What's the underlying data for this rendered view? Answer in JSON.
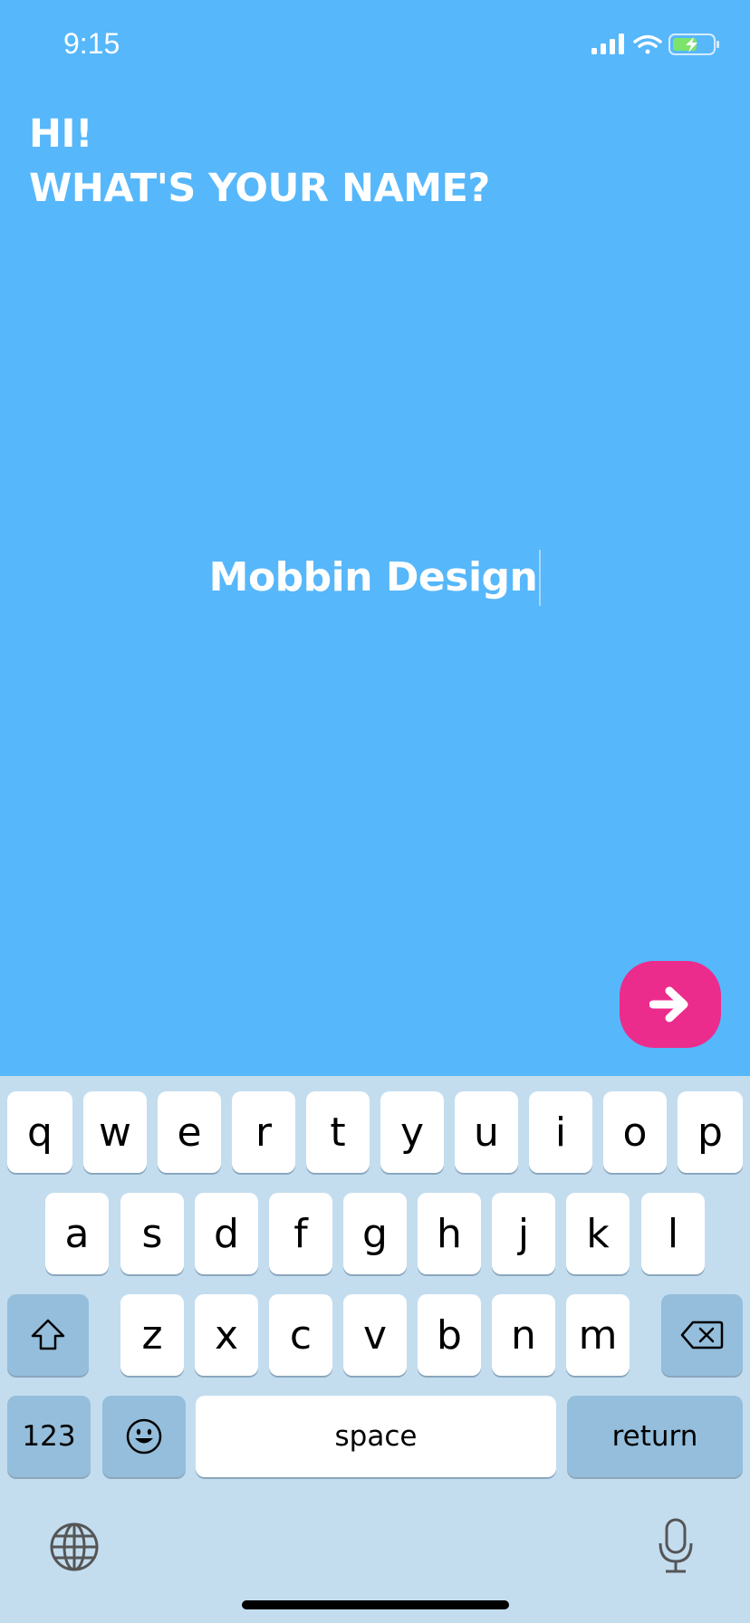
{
  "status_bar": {
    "time": "9:15"
  },
  "heading": {
    "line1": "HI!",
    "line2": "WHAT'S YOUR NAME?"
  },
  "name_input": {
    "value": "Mobbin Design"
  },
  "next_button": {
    "icon": "arrow-right-icon",
    "color": "#EC2C8C"
  },
  "colors": {
    "background": "#56B7FB",
    "keyboard": "#C3DDEF"
  },
  "keyboard": {
    "row1": [
      "q",
      "w",
      "e",
      "r",
      "t",
      "y",
      "u",
      "i",
      "o",
      "p"
    ],
    "row2": [
      "a",
      "s",
      "d",
      "f",
      "g",
      "h",
      "j",
      "k",
      "l"
    ],
    "row3": [
      "z",
      "x",
      "c",
      "v",
      "b",
      "n",
      "m"
    ],
    "numbers_label": "123",
    "space_label": "space",
    "return_label": "return"
  }
}
